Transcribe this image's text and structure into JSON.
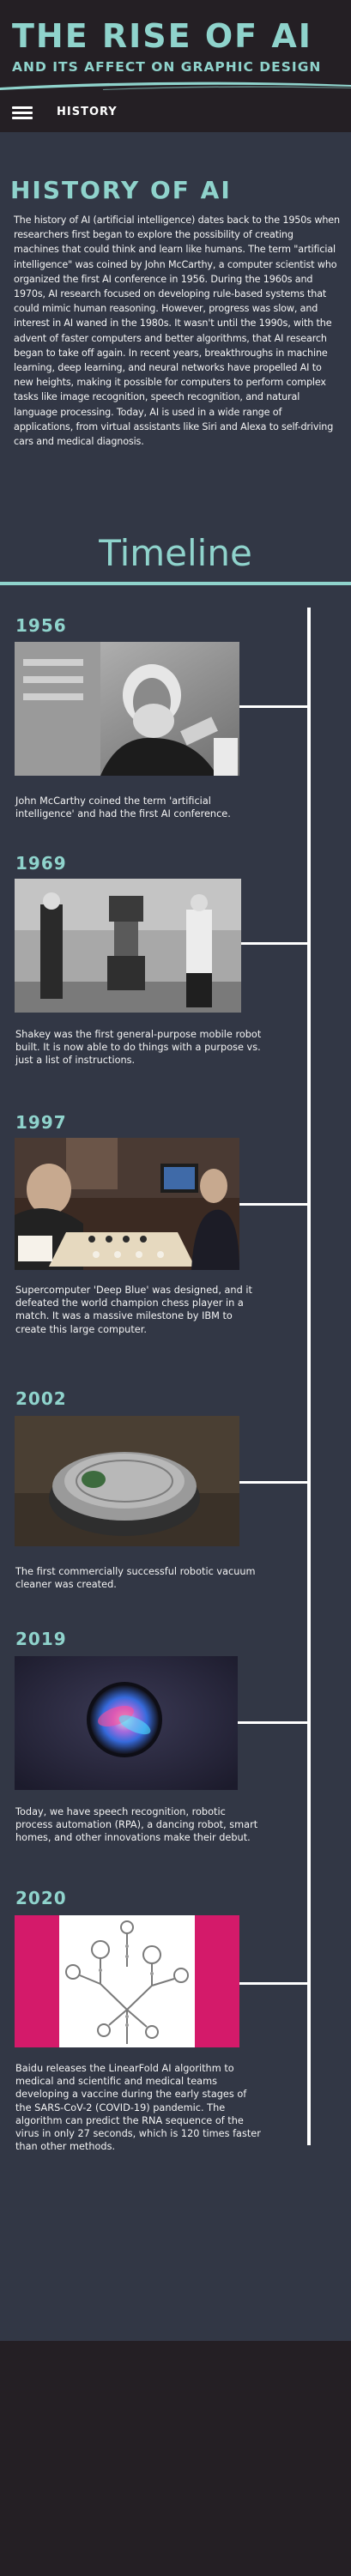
{
  "header": {
    "title": "THE RISE OF AI",
    "subtitle": "AND ITS AFFECT ON GRAPHIC DESIGN"
  },
  "nav": {
    "menu_icon": "hamburger-menu-icon",
    "link": "HISTORY"
  },
  "history": {
    "heading": "HISTORY OF AI",
    "body": "The history of AI (artificial intelligence) dates back to the 1950s when researchers first began to explore the possibility of creating machines that could think and learn like humans. The term \"artificial intelligence\" was coined by John McCarthy, a computer scientist who organized the first AI conference in 1956. During the 1960s and 1970s, AI research focused on developing rule-based systems that could mimic human reasoning. However, progress was slow, and interest in AI waned in the 1980s. It wasn't until the 1990s, with the advent of faster computers and better algorithms, that AI research began to take off again. In recent years, breakthroughs in machine learning, deep learning, and neural networks have propelled AI to new heights, making it possible for computers to perform complex tasks like image recognition, speech recognition, and natural language processing. Today, AI is used in a wide range of applications, from virtual assistants like Siri and Alexa to self-driving cars and medical diagnosis."
  },
  "timeline": {
    "heading": "Timeline",
    "events": [
      {
        "year": "1956",
        "caption": "John McCarthy coined the term 'artificial intelligence' and had the first AI conference."
      },
      {
        "year": "1969",
        "caption": "Shakey was the first general-purpose mobile robot built. It is now able to do things with a purpose vs. just a list of instructions."
      },
      {
        "year": "1997",
        "caption": "Supercomputer 'Deep Blue' was designed, and it defeated the world champion chess player in a match. It was a massive milestone by IBM to create this large computer."
      },
      {
        "year": "2002",
        "caption": "The first commercially successful robotic vacuum cleaner was created."
      },
      {
        "year": "2019",
        "caption": "Today, we have speech recognition, robotic process automation (RPA), a dancing robot, smart homes, and other innovations make their debut."
      },
      {
        "year": "2020",
        "caption": "Baidu releases the LinearFold AI algorithm to medical and scientific and medical teams developing a vaccine during the early stages of the SARS-CoV-2 (COVID-19) pandemic. The algorithm can predict the RNA sequence of the virus in only 27 seconds, which is 120 times faster than other methods."
      }
    ]
  },
  "colors": {
    "accent": "#8fd3cc",
    "header_bg": "#241f24",
    "content_bg": "#323745",
    "timeline_line": "#ffffff",
    "rna_pink": "#d41a6a"
  }
}
